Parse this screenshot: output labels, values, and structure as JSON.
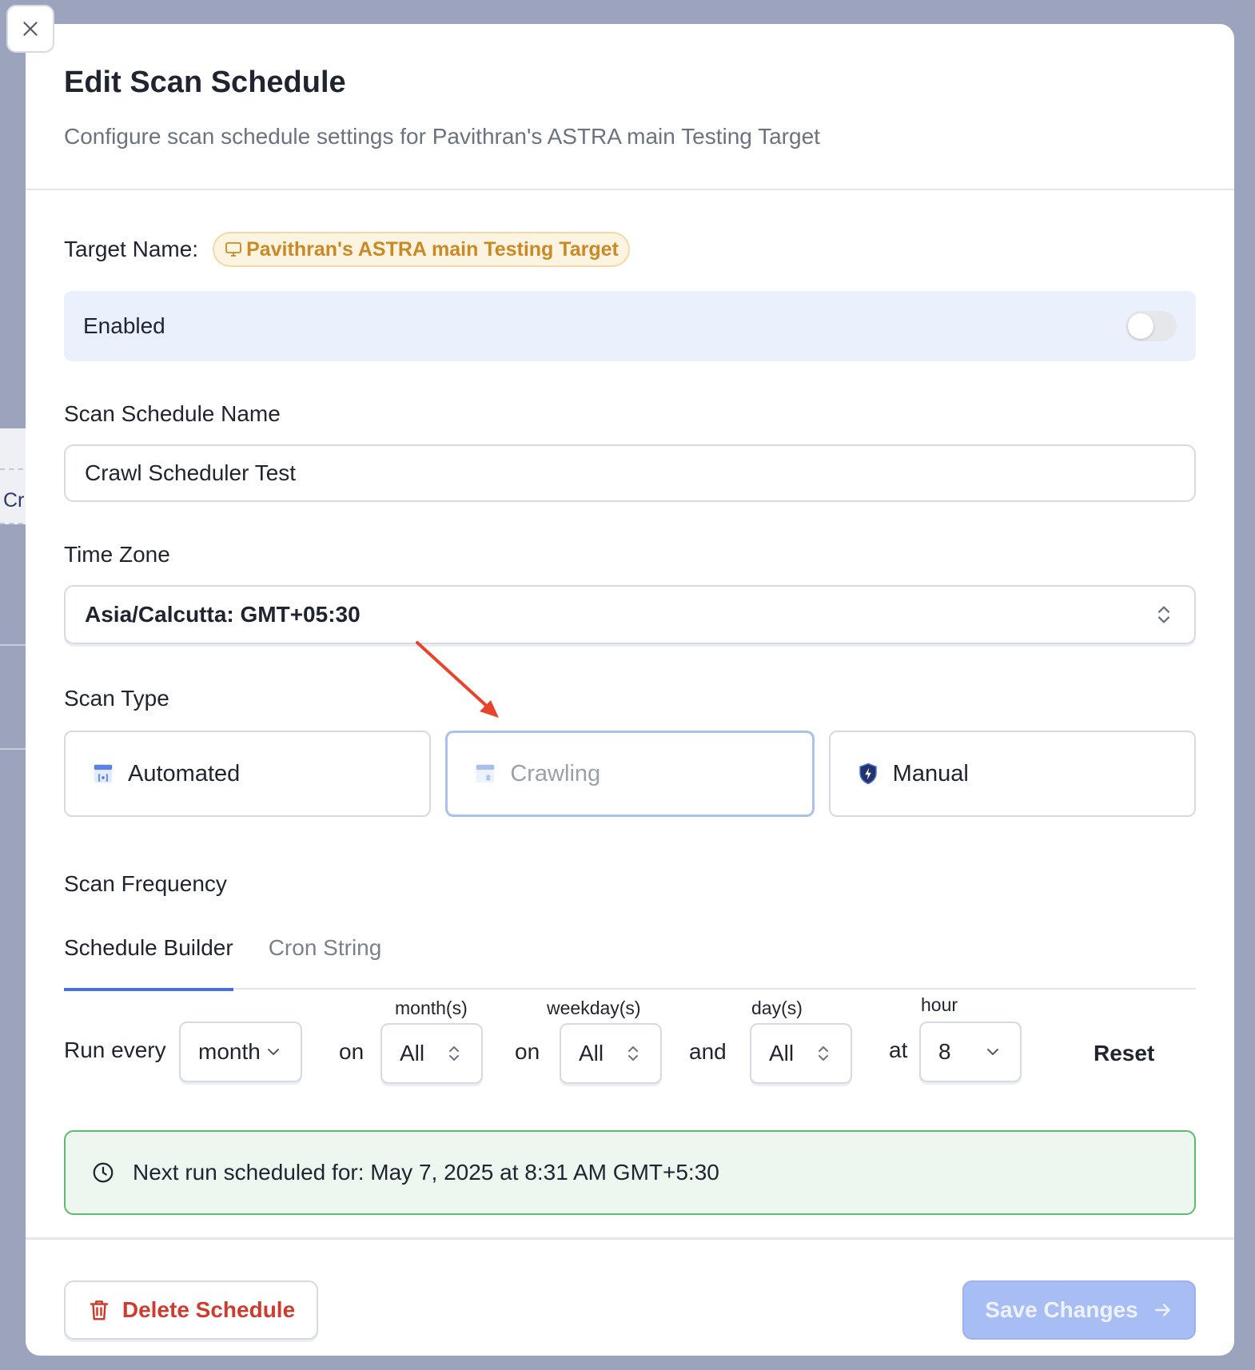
{
  "background": {
    "fragment": "Cr"
  },
  "modal": {
    "title": "Edit Scan Schedule",
    "subtitle": "Configure scan schedule settings for Pavithran's ASTRA main Testing Target"
  },
  "target": {
    "label": "Target Name:",
    "value": "Pavithran's ASTRA main Testing Target"
  },
  "enabled": {
    "label": "Enabled",
    "on": false
  },
  "schedule_name": {
    "label": "Scan Schedule Name",
    "value": "Crawl Scheduler Test"
  },
  "time_zone": {
    "label": "Time Zone",
    "value": "Asia/Calcutta: GMT+05:30"
  },
  "scan_type": {
    "label": "Scan Type",
    "options": [
      "Automated",
      "Crawling",
      "Manual"
    ],
    "selected": "Crawling"
  },
  "scan_frequency": {
    "label": "Scan Frequency",
    "tabs": [
      "Schedule Builder",
      "Cron String"
    ],
    "active_tab": "Schedule Builder"
  },
  "builder": {
    "run_every": "Run every",
    "period": "month",
    "on1": "on",
    "months_caption": "month(s)",
    "months": "All",
    "on2": "on",
    "weekdays_caption": "weekday(s)",
    "weekdays": "All",
    "and": "and",
    "days_caption": "day(s)",
    "days": "All",
    "at": "at",
    "hour_caption": "hour",
    "hour": "8",
    "reset": "Reset"
  },
  "next_run": "Next run scheduled for: May 7, 2025 at 8:31 AM GMT+5:30",
  "footer": {
    "delete": "Delete Schedule",
    "save": "Save Changes"
  },
  "colors": {
    "accent": "#4a6fdc",
    "danger": "#d13a2f",
    "success_border": "#5cbc6c",
    "target_pill": "#c98a25",
    "annotation_arrow": "#e8432d"
  }
}
